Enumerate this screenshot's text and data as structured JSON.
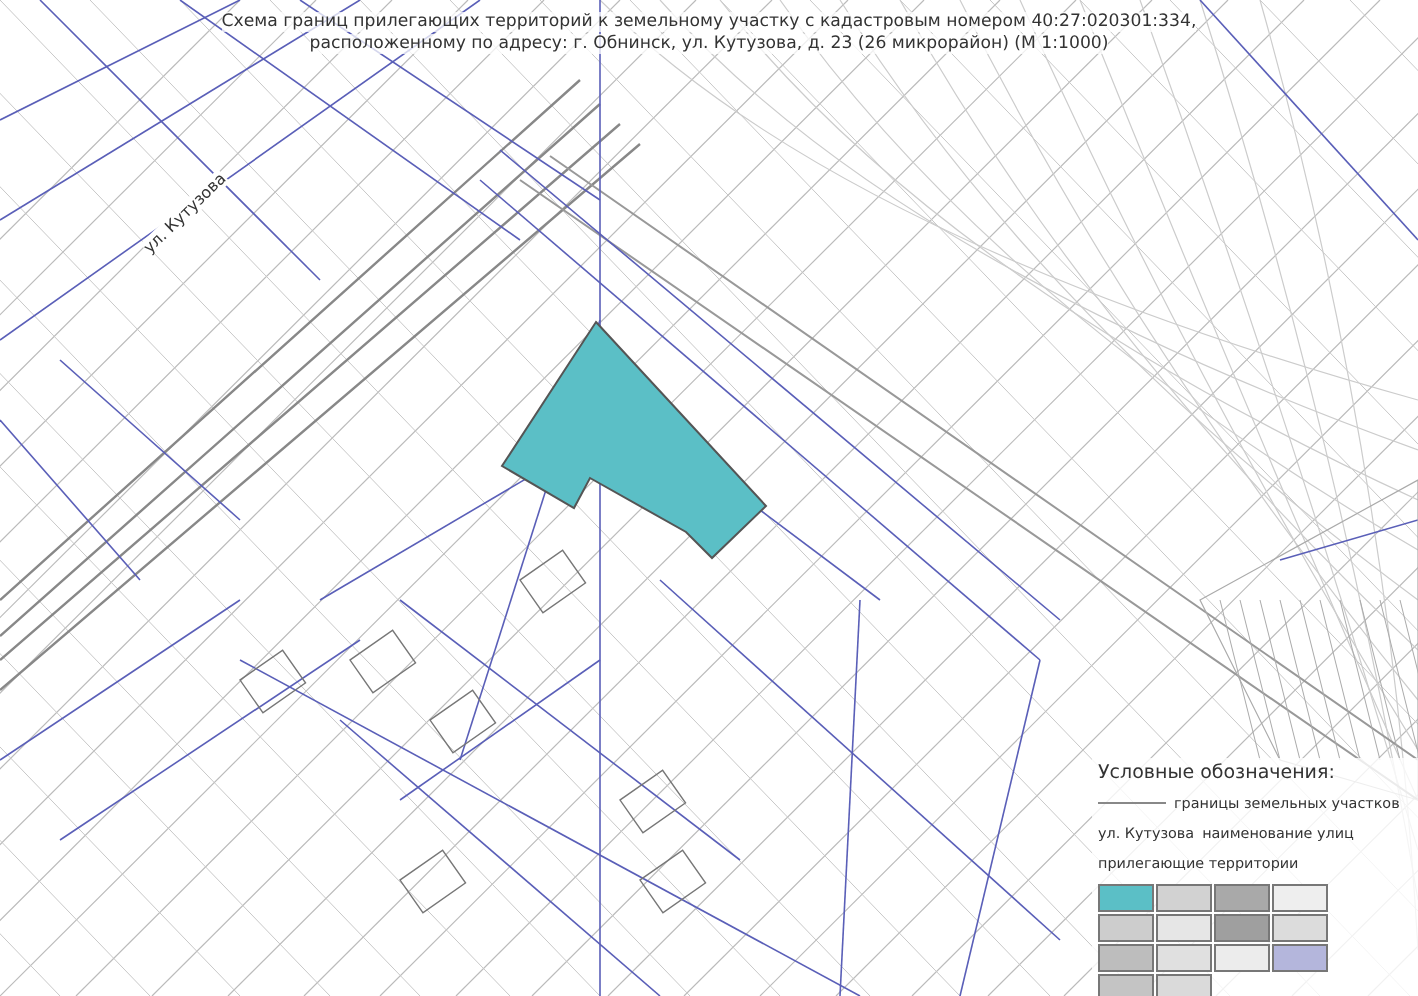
{
  "title": {
    "lines": [
      "Схема границ прилегающих территорий к земельному участку с кадастровым номером 40:27:020301:334,",
      "расположенному по адресу: г. Обнинск, ул. Кутузова, д. 23 (26 микрорайон) (М 1:1000)"
    ]
  },
  "map": {
    "street_label": "ул. Кутузова"
  },
  "legend": {
    "title": "Условные обозначения:",
    "items": [
      {
        "kind": "line",
        "text": "границы земельных участков"
      },
      {
        "kind": "street",
        "sample": "ул. Кутузова",
        "text": "наименование улиц"
      },
      {
        "kind": "heading",
        "text": "прилегающие территории"
      }
    ],
    "swatches": [
      {
        "color": "#5bbfc6"
      },
      {
        "color": "#d2d2d2"
      },
      {
        "color": "#a9a9a9"
      },
      {
        "color": "#eeeeee"
      },
      {
        "color": "#cdcdcd"
      },
      {
        "color": "#e6e6e6"
      },
      {
        "color": "#9f9f9f"
      },
      {
        "color": "#dcdcdc"
      },
      {
        "color": "#bdbdbd"
      },
      {
        "color": "#e0e0e0"
      },
      {
        "color": "#ececec"
      },
      {
        "color": "#b4b6dc"
      },
      {
        "color": "#c4c4c4"
      },
      {
        "color": "#dadada"
      }
    ]
  }
}
